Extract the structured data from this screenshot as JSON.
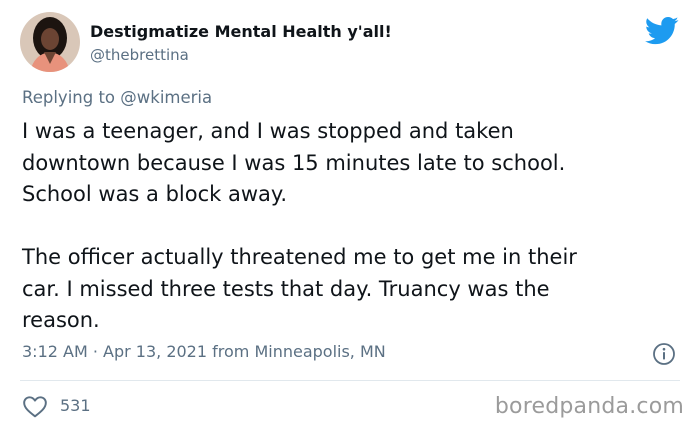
{
  "tweet": {
    "display_name": "Destigmatize Mental Health y'all!",
    "handle": "@thebrettina",
    "reply_prefix": "Replying to",
    "reply_to": "@wkimeria",
    "text_lines": [
      "I was a teenager, and I was stopped and taken",
      "downtown because I was 15 minutes late to school.",
      "School was a block away.",
      "The officer actually threatened me to get me in their",
      "car. I missed three tests that day. Truancy was the",
      "reason."
    ],
    "timestamp": "3:12 AM · Apr 13, 2021 from Minneapolis, MN",
    "likes": "531"
  },
  "icons": {
    "platform": "twitter-bird-icon",
    "info": "info-icon",
    "like": "heart-icon"
  },
  "colors": {
    "twitter_blue": "#1d9bf0",
    "secondary_text": "#5b7083",
    "primary_text": "#0f1419",
    "watermark": "#9b9b9b"
  },
  "watermark": "boredpanda.com"
}
